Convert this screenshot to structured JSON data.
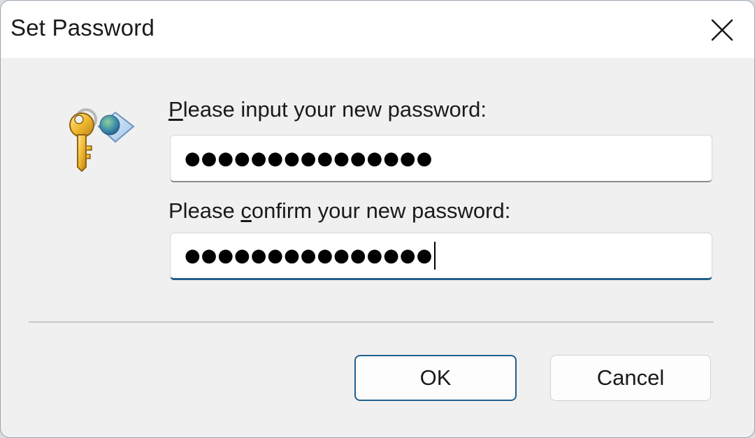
{
  "window": {
    "title": "Set Password"
  },
  "icons": {
    "close": "close-icon",
    "key": "key-icon"
  },
  "form": {
    "new_password": {
      "label_mnemonic": "P",
      "label_rest": "lease input your new password:",
      "masked_value": "●●●●●●●●●●●●●●●"
    },
    "confirm_password": {
      "label_prefix": "Please ",
      "label_mnemonic": "c",
      "label_rest": "onfirm your new password:",
      "masked_value": "●●●●●●●●●●●●●●●"
    }
  },
  "buttons": {
    "ok_label": "OK",
    "cancel_label": "Cancel"
  },
  "colors": {
    "accent": "#1f5f8c",
    "dialog_background": "#f0f0f0",
    "titlebar_background": "#ffffff"
  }
}
